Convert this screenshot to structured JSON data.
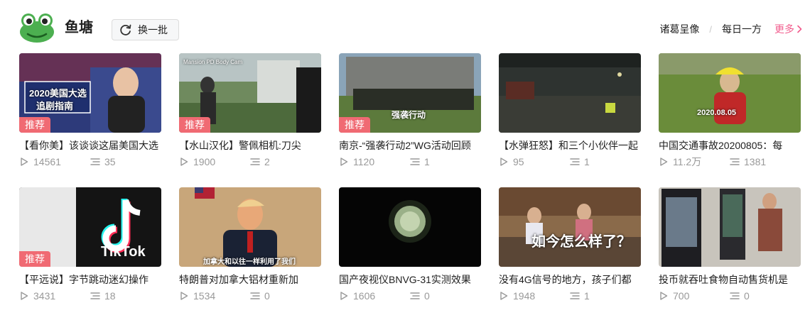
{
  "header": {
    "title": "鱼塘",
    "refresh_label": "换一批",
    "links": [
      "诸葛呈像",
      "每日一方"
    ],
    "more_label": "更多",
    "accent_color": "#f25d8e"
  },
  "badge_label": "推荐",
  "videos": [
    {
      "title": "【看你美】该谈谈这届美国大选",
      "views": "14561",
      "danmaku": "35",
      "recommended": true,
      "overlay": [
        "2020美国大选",
        "追剧指南"
      ]
    },
    {
      "title": "【水山汉化】警佩相机:刀尖",
      "views": "1900",
      "danmaku": "2",
      "recommended": true,
      "overlay": [
        "Mansion PD Body Cam"
      ]
    },
    {
      "title": "南京-“强袭行动2”WG活动回顾",
      "views": "1120",
      "danmaku": "1",
      "recommended": true,
      "overlay": [
        "强袭行动"
      ]
    },
    {
      "title": "【水弹狂怒】和三个小伙伴一起",
      "views": "95",
      "danmaku": "1",
      "recommended": false,
      "overlay": []
    },
    {
      "title": "中国交通事故20200805：每",
      "views": "11.2万",
      "danmaku": "1381",
      "recommended": false,
      "overlay": [
        "2020.08.05"
      ]
    },
    {
      "title": "【平远说】字节跳动迷幻操作",
      "views": "3431",
      "danmaku": "18",
      "recommended": true,
      "overlay": [
        "TikTok"
      ]
    },
    {
      "title": "特朗普对加拿大铝材重新加",
      "views": "1534",
      "danmaku": "0",
      "recommended": false,
      "overlay": [
        "加拿大和以往一样利用了我们"
      ]
    },
    {
      "title": "国产夜视仪BNVG-31实测效果",
      "views": "1606",
      "danmaku": "0",
      "recommended": false,
      "overlay": []
    },
    {
      "title": "没有4G信号的地方，孩子们都",
      "views": "1948",
      "danmaku": "1",
      "recommended": false,
      "overlay": [
        "如今怎么样了？"
      ]
    },
    {
      "title": "投币就吞吐食物自动售货机是",
      "views": "700",
      "danmaku": "0",
      "recommended": false,
      "overlay": []
    }
  ]
}
